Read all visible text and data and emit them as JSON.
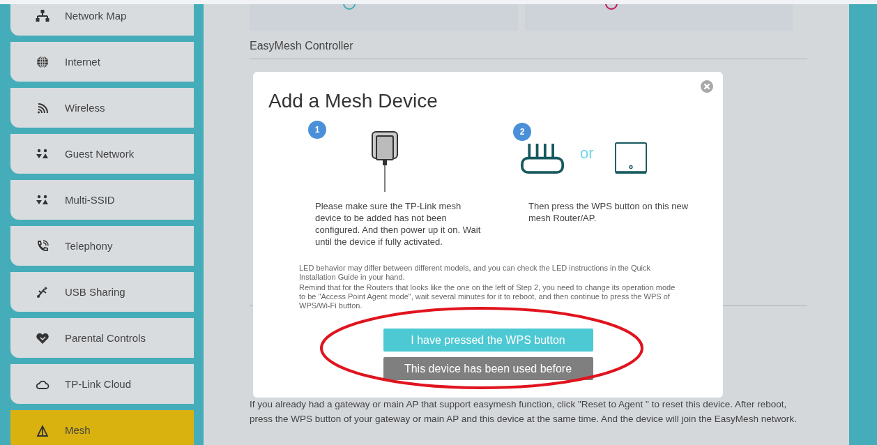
{
  "sidebar": {
    "items": [
      {
        "label": "Network Map",
        "selected": false
      },
      {
        "label": "Internet",
        "selected": false
      },
      {
        "label": "Wireless",
        "selected": false
      },
      {
        "label": "Guest Network",
        "selected": false
      },
      {
        "label": "Multi-SSID",
        "selected": false
      },
      {
        "label": "Telephony",
        "selected": false
      },
      {
        "label": "USB Sharing",
        "selected": false
      },
      {
        "label": "Parental Controls",
        "selected": false
      },
      {
        "label": "TP-Link Cloud",
        "selected": false
      },
      {
        "label": "Mesh",
        "selected": true
      }
    ]
  },
  "main": {
    "section_title": "EasyMesh Controller",
    "description": "If you already had a gateway or main AP that support easymesh function, click \"Reset to Agent \" to reset this device. After reboot, press the WPS button of your gateway or main AP and this device at the same time. And the device will join the EasyMesh network."
  },
  "dialog": {
    "title": "Add a Mesh Device",
    "steps": [
      {
        "number": "1",
        "text": "Please make sure the TP-Link mesh device to be added has not been configured. And then power up it on. Wait until the device if fully activated."
      },
      {
        "number": "2",
        "or": "or",
        "text": "Then press the WPS button on this new mesh Router/AP."
      }
    ],
    "notes": [
      "LED behavior may differ between different models, and you can check the LED instructions in the Quick Installation Guide in your hand.",
      "Remind that for the Routers that looks like the one on the left of Step 2, you need to change its operation mode to be \"Access Point Agent mode\", wait several minutes for it to reboot, and then continue to press the WPS of WPS/Wi-Fi button."
    ],
    "buttons": [
      {
        "label": "I have pressed the WPS button",
        "kind": "primary"
      },
      {
        "label": "This device has been used before",
        "kind": "secondary"
      }
    ]
  }
}
